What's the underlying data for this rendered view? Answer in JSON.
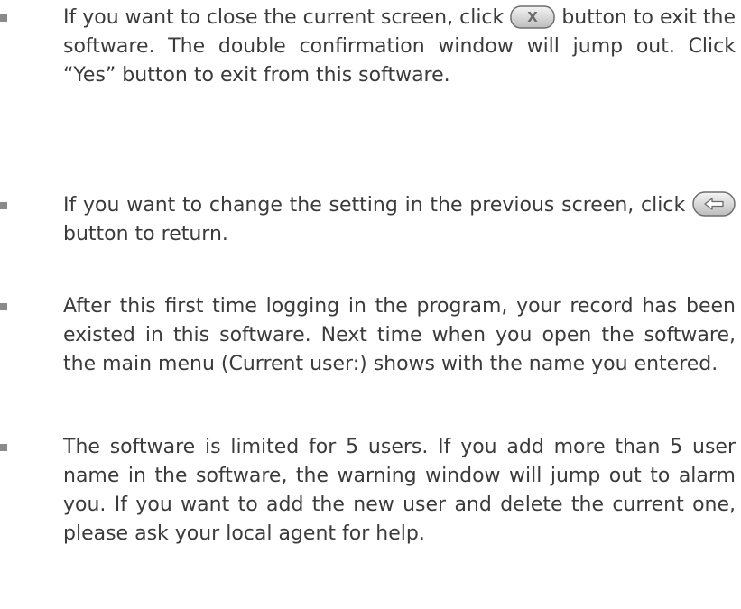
{
  "items": [
    {
      "before_icon": "If you want to close the current screen, click",
      "icon": "close-x-button-icon",
      "after_icon": "button to exit the software. The double confirmation window will jump out. Click “Yes” button to exit from this software."
    },
    {
      "before_icon": "If you want to change the setting in the previous screen, click",
      "icon": "back-arrow-button-icon",
      "after_icon": "button to return."
    },
    {
      "text": "After this first time logging in the program, your record has been existed in this software. Next time when you open the software, the main menu (Current user:) shows with the name you entered."
    },
    {
      "text": "The software is limited for 5 users. If you add more than 5 user name in the software, the warning window will jump out to alarm you. If you want to add the new user and delete the current one, please ask your local agent for help."
    }
  ]
}
